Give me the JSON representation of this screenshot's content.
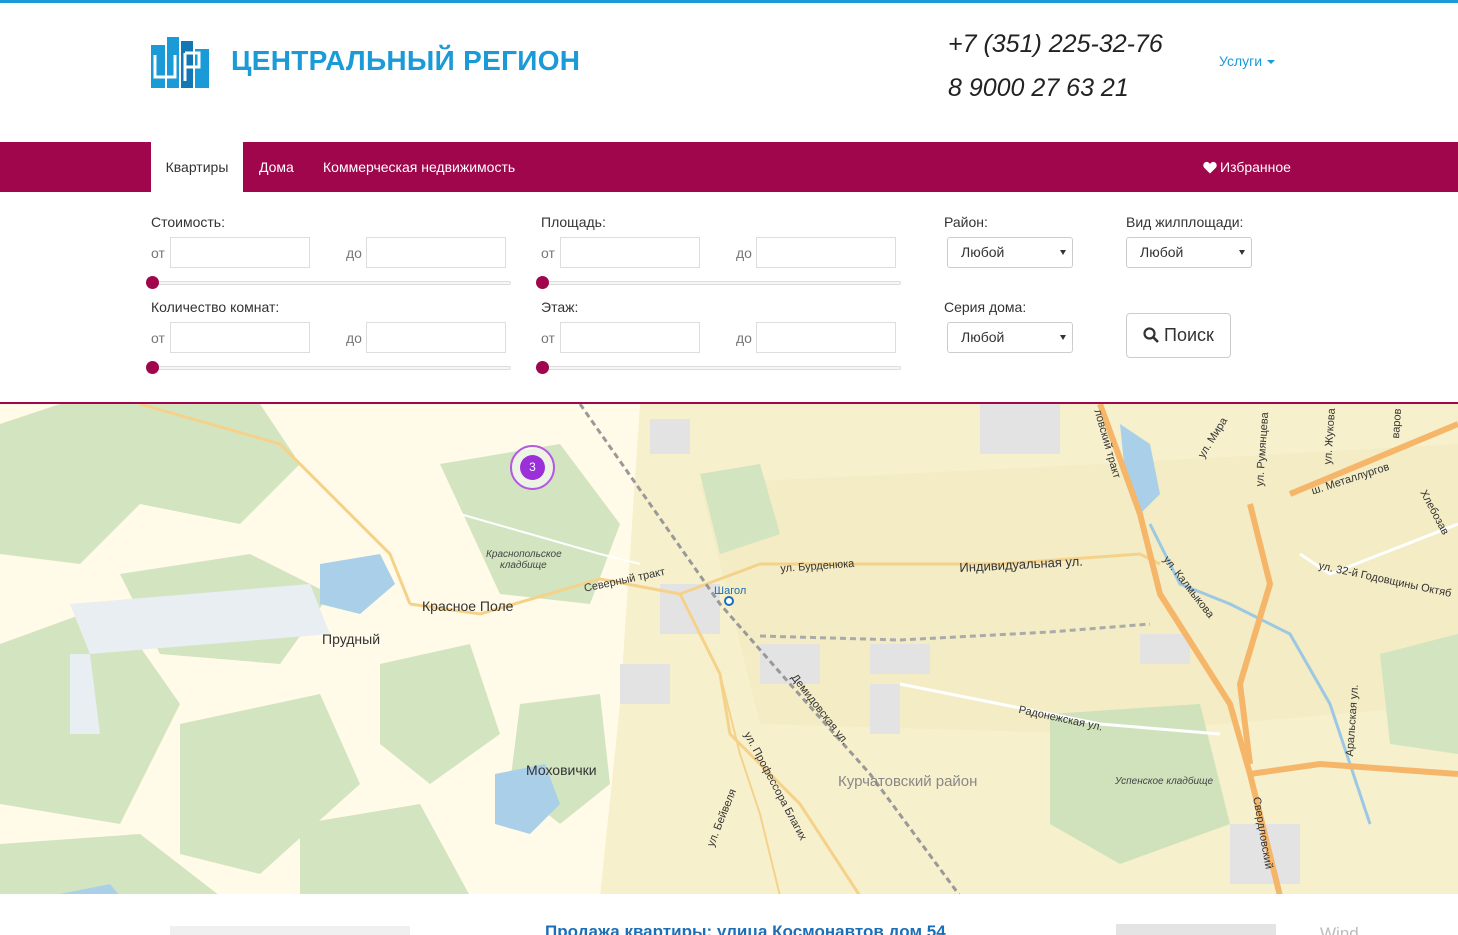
{
  "header": {
    "brand": "ЦЕНТРАЛЬНЫЙ РЕГИОН",
    "logo_icon": "building-logo-icon",
    "phone1": "+7 (351) 225-32-76",
    "phone2": "8 9000 27 63 21",
    "services_label": "Услуги",
    "accent_color": "#1a9ad6"
  },
  "nav": {
    "color": "#a0064c",
    "tabs": [
      {
        "label": "Квартиры",
        "active": true
      },
      {
        "label": "Дома",
        "active": false
      },
      {
        "label": "Коммерческая недвижимость",
        "active": false
      }
    ],
    "favorites_label": "Избранное",
    "favorites_icon": "heart-icon"
  },
  "filters": {
    "from_label": "от",
    "to_label": "до",
    "cost_label": "Стоимость:",
    "area_label": "Площадь:",
    "rooms_label": "Количество комнат:",
    "floor_label": "Этаж:",
    "district_label": "Район:",
    "district_value": "Любой",
    "housing_type_label": "Вид жилплощади:",
    "housing_type_value": "Любой",
    "series_label": "Серия дома:",
    "series_value": "Любой",
    "search_label": "Поиск",
    "search_icon": "magnifier-icon"
  },
  "map": {
    "cluster_count": "3",
    "labels": {
      "krasnoe_pole": "Красное Поле",
      "prudny": "Прудный",
      "mokhovichki": "Моховички",
      "kurchatov": "Курчатовский район",
      "krasnopol_cemetery_1": "Краснопольское",
      "krasnopol_cemetery_2": "кладбище",
      "uspenskoe": "Успенское кладбище",
      "severny_trakt": "Северный тракт",
      "burdenyuka": "ул. Бурденюка",
      "individualnaya": "Индивидуальная ул.",
      "shagol": "Шагол",
      "demidovskaya": "Демидовская ул.",
      "radonezhskaya": "Радонежская ул.",
      "blagikh": "ул. Профессора Благих",
      "beyvelya": "ул. Бейвеля",
      "sverdlovsky_top": "ловский тракт",
      "sverdlovsky_bottom": "Свердловский",
      "kalmykova": "ул. Калмыкова",
      "metallurgov": "ш. Металлургов",
      "godovshchiny": "ул. 32-й Годовщины Октяб",
      "mira": "ул. Мира",
      "rumyantseva": "ул. Румянцева",
      "zhukova": "ул. Жукова",
      "varov": "варов",
      "khleboza": "Хлебозав",
      "aralskaya": "Аральская ул."
    }
  },
  "listing": {
    "title": "Продажа квартиры: улица Космонавтов дом 54",
    "faded_text": "Wind"
  }
}
